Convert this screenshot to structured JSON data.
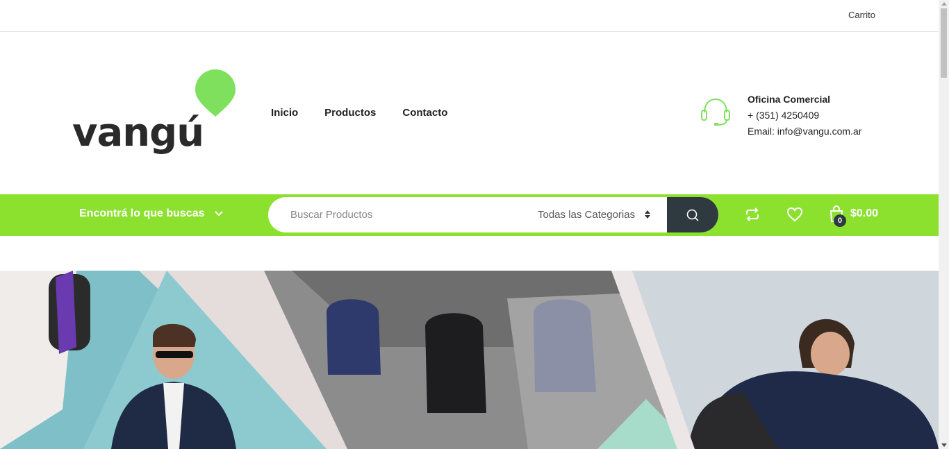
{
  "topbar": {
    "cart_label": "Carrito"
  },
  "brand": {
    "name": "vangú",
    "accent_color": "#7ee05c"
  },
  "nav": {
    "items": [
      {
        "label": "Inicio"
      },
      {
        "label": "Productos"
      },
      {
        "label": "Contacto"
      }
    ]
  },
  "office": {
    "title": "Oficina Comercial",
    "phone": "+ (351) 4250409",
    "email": "Email: info@vangu.com.ar",
    "icon": "headset-icon"
  },
  "searchbar": {
    "background_color": "#8ce12e",
    "category_toggle_label": "Encontrá lo que buscas",
    "search_placeholder": "Buscar Productos",
    "category_select_value": "Todas las Categorias",
    "search_button_icon": "search-icon",
    "compare_icon": "compare-icon",
    "wishlist_icon": "heart-icon",
    "cart_icon": "shopping-bag-icon",
    "cart_count": "0",
    "cart_total": "$0.00"
  },
  "hero": {
    "description_icon": "hero-banner-image"
  }
}
